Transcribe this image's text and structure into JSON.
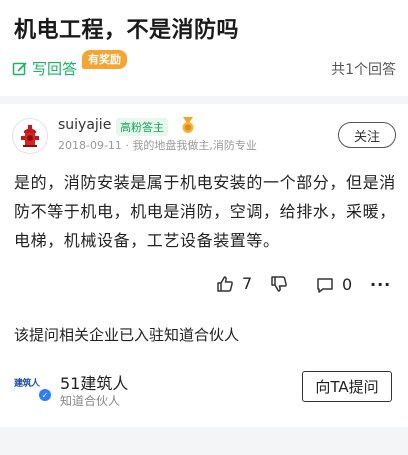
{
  "question": {
    "title": "机电工程，不是消防吗"
  },
  "header_bar": {
    "write_answer_label": "写回答",
    "reward_badge": "有奖励",
    "answer_count": "共1个回答"
  },
  "answer": {
    "author": {
      "username": "suiyajie",
      "title_badge": "高粉答主",
      "avatar_icon": "fire-hydrant-icon"
    },
    "date": "2018-09-11",
    "meta_separator": "·",
    "bio": "我的地盘我做主,消防专业",
    "follow_label": "关注",
    "text": "是的，消防安装是属于机电安装的一个部分，但是消防不等于机电，机电是消防，空调，给排水，采暖，电梯，机械设备，工艺设备装置等。",
    "likes": "7",
    "comments": "0",
    "more_icon": "···"
  },
  "company": {
    "note": "该提问相关企业已入驻知道合伙人",
    "logo_text": "建筑人",
    "name": "51建筑人",
    "subtitle": "知道合伙人",
    "ask_label": "向TA提问"
  },
  "colors": {
    "accent_green": "#17b463",
    "reward_orange": "#f7a531",
    "verify_blue": "#2d7ff9"
  }
}
